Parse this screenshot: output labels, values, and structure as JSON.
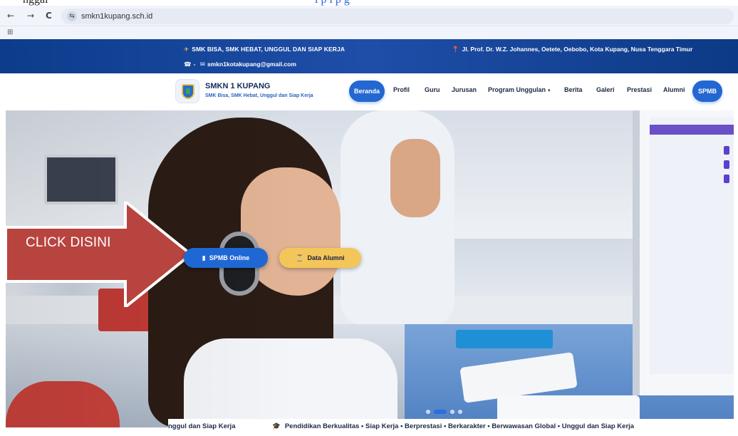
{
  "caption": {
    "left_text": "nggal",
    "right_text": "l                 p              l      p      g"
  },
  "browser": {
    "back_glyph": "←",
    "forward_glyph": "→",
    "reload_glyph": "C",
    "url": "smkn1kupang.sch.id",
    "site_icon_glyph": "⇆",
    "apps_glyph": "⊞"
  },
  "topbar": {
    "tagline": "SMK BISA, SMK HEBAT, UNGGUL DAN SIAP KERJA",
    "phone_dash": "-",
    "email": "smkn1kotakupang@gmail.com",
    "address": "Jl. Prof. Dr. W.Z. Johannes, Oetete, Oebobo, Kota Kupang, Nusa Tenggara Timur",
    "rocket_glyph": "✈",
    "phone_glyph": "☎",
    "mail_glyph": "✉",
    "pin_glyph": "📍"
  },
  "nav": {
    "brand_title": "SMKN 1 KUPANG",
    "brand_subtitle": "SMK Bisa, SMK Hebat, Unggul dan Siap Kerja",
    "items": {
      "beranda": "Beranda",
      "profil": "Profil",
      "guru": "Guru",
      "jurusan": "Jurusan",
      "program_unggulan": "Program Unggulan",
      "berita": "Berita",
      "galeri": "Galeri",
      "prestasi": "Prestasi",
      "alumni": "Alumni",
      "spmb": "SPMB"
    },
    "chevron_glyph": "▾"
  },
  "hero": {
    "cta_label": "CLICK DISINI",
    "btn_spmb": "SPMB Online",
    "btn_alumni": "Data Alumni",
    "btn_spmb_icon": "▮",
    "btn_alumni_icon": "⏳",
    "slides": 4,
    "active_slide": 2
  },
  "ticker": {
    "lead": "nggul dan Siap Kerja",
    "icon": "🎓",
    "text": "Pendidikan Berkualitas • Siap Kerja • Berprestasi • Berkarakter • Berwawasan Global • Unggul dan Siap Kerja"
  },
  "colors": {
    "brand_blue": "#2367d1",
    "topbar_navy": "#0d3c8c",
    "alumni_yellow": "#f4c65a",
    "arrow_red": "#b8443f"
  }
}
